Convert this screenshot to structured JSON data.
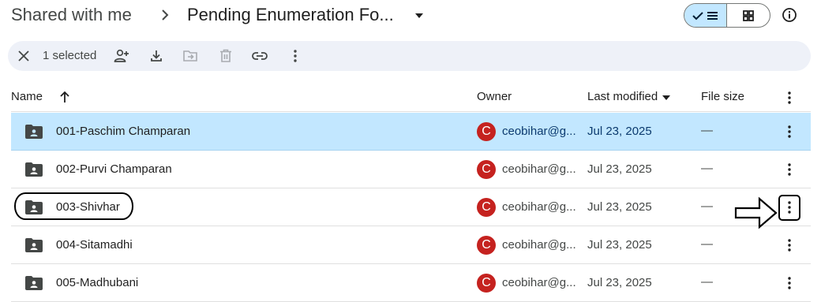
{
  "breadcrumb": {
    "root": "Shared with me",
    "current": "Pending Enumeration Fo..."
  },
  "view": {
    "active": "list"
  },
  "toolbar": {
    "selected_count": "1 selected"
  },
  "columns": {
    "name": "Name",
    "owner": "Owner",
    "last_modified": "Last modified",
    "file_size": "File size"
  },
  "rows": [
    {
      "name": "001-Paschim Champaran",
      "avatar": "C",
      "owner": "ceobihar@g...",
      "modified": "Jul 23, 2025",
      "size": "—"
    },
    {
      "name": "002-Purvi Champaran",
      "avatar": "C",
      "owner": "ceobihar@g...",
      "modified": "Jul 23, 2025",
      "size": "—"
    },
    {
      "name": "003-Shivhar",
      "avatar": "C",
      "owner": "ceobihar@g...",
      "modified": "Jul 23, 2025",
      "size": "—"
    },
    {
      "name": "004-Sitamadhi",
      "avatar": "C",
      "owner": "ceobihar@g...",
      "modified": "Jul 23, 2025",
      "size": "—"
    },
    {
      "name": "005-Madhubani",
      "avatar": "C",
      "owner": "ceobihar@g...",
      "modified": "Jul 23, 2025",
      "size": "—"
    }
  ],
  "colors": {
    "selected_row": "#c2e7ff",
    "toolbar_bg": "#eef1f8",
    "avatar": "#c5221f",
    "border": "#e0e0e0"
  },
  "icons": {
    "close": "close-icon",
    "share": "add-person-icon",
    "download": "download-icon",
    "move": "move-to-folder-icon",
    "trash": "trash-icon",
    "link": "link-icon",
    "more": "more-vert-icon",
    "folder": "shared-folder-icon",
    "info": "info-icon"
  }
}
